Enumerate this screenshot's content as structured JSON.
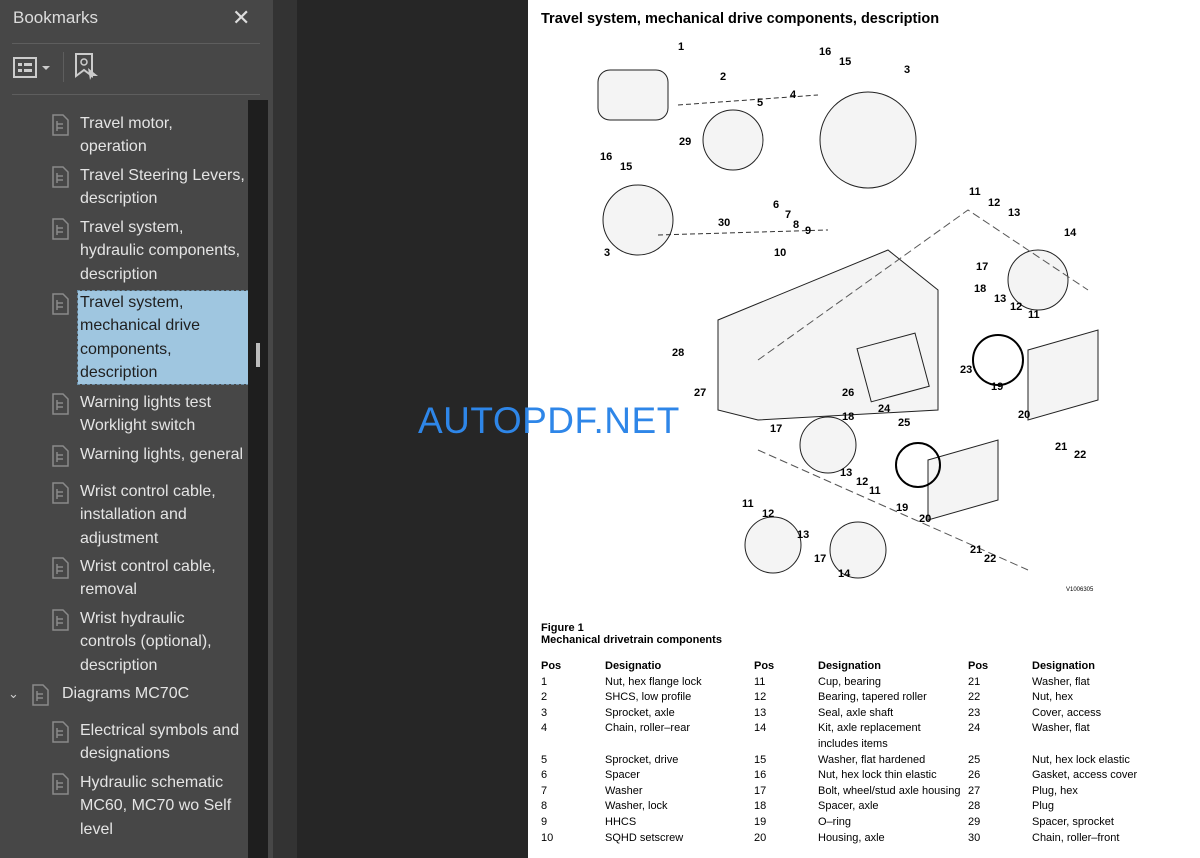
{
  "sidebar": {
    "title": "Bookmarks",
    "close_icon": "close-icon",
    "options_icon": "list-options-icon",
    "find_icon": "bookmark-find-icon",
    "items": [
      {
        "label": "Travel motor, operation",
        "lines": [
          "Travel motor,",
          "operation"
        ]
      },
      {
        "label": "Travel Steering Levers, description",
        "lines": [
          "Travel Steering Levers,",
          "description"
        ]
      },
      {
        "label": "Travel system, hydraulic components, description",
        "lines": [
          "Travel system,",
          "hydraulic components,",
          "description"
        ]
      },
      {
        "label": "Travel system, mechanical drive components, description",
        "lines": [
          "Travel system,",
          "mechanical drive",
          "components,",
          "description"
        ],
        "selected": true
      },
      {
        "label": "Warning lights test Worklight switch",
        "lines": [
          "Warning lights test",
          "Worklight switch"
        ]
      },
      {
        "label": "Warning lights, general",
        "lines": [
          "Warning lights, general"
        ]
      },
      {
        "label": "Wrist control cable, installation and adjustment",
        "lines": [
          "Wrist control cable,",
          "installation and",
          "adjustment"
        ]
      },
      {
        "label": "Wrist control cable, removal",
        "lines": [
          "Wrist control cable,",
          "removal"
        ]
      },
      {
        "label": "Wrist hydraulic controls (optional), description",
        "lines": [
          "Wrist hydraulic",
          "controls (optional),",
          "description"
        ]
      },
      {
        "label": "Diagrams MC70C",
        "lines": [
          "Diagrams MC70C"
        ],
        "top": true,
        "expanded": true
      },
      {
        "label": "Electrical symbols and designations",
        "lines": [
          "Electrical symbols and",
          "designations"
        ]
      },
      {
        "label": "Hydraulic schematic MC60, MC70 wo Self level",
        "lines": [
          "Hydraulic schematic",
          "MC60, MC70 wo Self",
          "level"
        ]
      }
    ]
  },
  "page": {
    "title": "Travel system, mechanical drive components, description",
    "figure_label": "Figure 1",
    "figure_caption": "Mechanical drivetrain components",
    "image_code": "V1006305",
    "callouts": [
      "1",
      "2",
      "16",
      "15",
      "3",
      "5",
      "4",
      "29",
      "16",
      "15",
      "6",
      "7",
      "8",
      "9",
      "30",
      "3",
      "10",
      "11",
      "12",
      "13",
      "14",
      "17",
      "18",
      "13",
      "12",
      "11",
      "28",
      "26",
      "23",
      "19",
      "27",
      "24",
      "25",
      "18",
      "17",
      "20",
      "13",
      "12",
      "11",
      "21",
      "22",
      "19",
      "11",
      "12",
      "20",
      "13",
      "17",
      "14",
      "21",
      "22"
    ],
    "table": {
      "headers": [
        "Pos",
        "Designatio",
        "Pos",
        "Designation",
        "Pos",
        "Designation"
      ],
      "rows": [
        [
          "1",
          "Nut, hex flange lock",
          "11",
          "Cup, bearing",
          "21",
          "Washer, flat"
        ],
        [
          "2",
          "SHCS, low profile",
          "12",
          "Bearing, tapered roller",
          "22",
          "Nut, hex"
        ],
        [
          "3",
          "Sprocket, axle",
          "13",
          "Seal, axle shaft",
          "23",
          "Cover, access"
        ],
        [
          "4",
          "Chain, roller–rear",
          "14",
          "Kit, axle replacement includes items",
          "24",
          "Washer, flat"
        ],
        [
          "5",
          "Sprocket, drive",
          "15",
          "Washer, flat hardened",
          "25",
          "Nut, hex lock elastic"
        ],
        [
          "6",
          "Spacer",
          "16",
          "Nut, hex lock thin elastic",
          "26",
          "Gasket, access cover"
        ],
        [
          "7",
          "Washer",
          "17",
          "Bolt, wheel/stud axle housing",
          "27",
          "Plug, hex"
        ],
        [
          "8",
          "Washer, lock",
          "18",
          "Spacer, axle",
          "28",
          "Plug"
        ],
        [
          "9",
          "HHCS",
          "19",
          "O–ring",
          "29",
          "Spacer, sprocket"
        ],
        [
          "10",
          "SQHD setscrew",
          "20",
          "Housing, axle",
          "30",
          "Chain, roller–front"
        ]
      ]
    }
  },
  "watermark": "AUTOPDF.NET",
  "colors": {
    "selection": "#9fc6e0",
    "watermark": "#2e86e8",
    "sidebar_bg": "#474747"
  }
}
